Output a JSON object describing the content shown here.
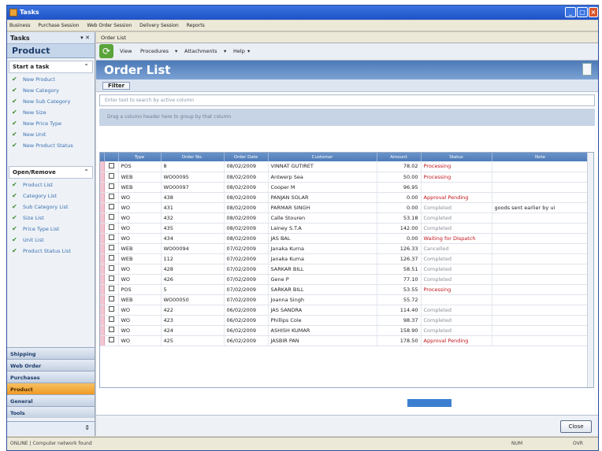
{
  "window": {
    "title": "Tasks"
  },
  "menu": [
    "Business",
    "Purchase Session",
    "Web Order Session",
    "Delivery Session",
    "Reports"
  ],
  "tasks_pane": {
    "header": "Tasks",
    "section_title": "Product",
    "group1": {
      "title": "Start a task",
      "items": [
        "New Product",
        "New Category",
        "New Sub Category",
        "New Size",
        "New Price Type",
        "New Unit",
        "New Product Status"
      ]
    },
    "group2": {
      "title": "Open/Remove",
      "items": [
        "Product List",
        "Category List",
        "Sub Category List",
        "Size List",
        "Price Type List",
        "Unit List",
        "Product Status List"
      ]
    },
    "nav": [
      "Shipping",
      "Web Order",
      "Purchases",
      "Product",
      "General",
      "Tools"
    ]
  },
  "doc_tab": "Order List",
  "toolbar": {
    "view": "View",
    "procedures": "Procedures",
    "attachments": "Attachments",
    "help": "Help"
  },
  "page_title": "Order List",
  "filter_label": "Filter",
  "search_placeholder": "Enter text to search by active column",
  "group_hint": "Drag a column header here to group by that column",
  "table": {
    "columns": [
      "",
      "Type",
      "Order No.",
      "Order Date",
      "Customer",
      "Amount",
      "Status",
      "Note"
    ],
    "rows": [
      {
        "type": "POS",
        "no": "8",
        "date": "08/02/2009",
        "cust": "VINNAT GUTIRET",
        "amt": "78.02",
        "status": "Processing",
        "sc": "red",
        "note": ""
      },
      {
        "type": "WEB",
        "no": "WO00095",
        "date": "08/02/2009",
        "cust": "Antwerp Sea",
        "amt": "50.00",
        "status": "Processing",
        "sc": "red",
        "note": ""
      },
      {
        "type": "WEB",
        "no": "WO00097",
        "date": "08/02/2009",
        "cust": "Cooper M",
        "amt": "96.95",
        "status": "",
        "sc": "gray",
        "note": ""
      },
      {
        "type": "WO",
        "no": "438",
        "date": "08/02/2009",
        "cust": "PANJAN SOLAR",
        "amt": "0.00",
        "status": "Approval Pending",
        "sc": "red",
        "note": ""
      },
      {
        "type": "WO",
        "no": "431",
        "date": "08/02/2009",
        "cust": "PARMAR SINGH",
        "amt": "0.00",
        "status": "Completed",
        "sc": "gray",
        "note": "goods sent earlier by ui"
      },
      {
        "type": "WO",
        "no": "432",
        "date": "08/02/2009",
        "cust": "Calle Stouren",
        "amt": "53.18",
        "status": "Completed",
        "sc": "gray",
        "note": ""
      },
      {
        "type": "WO",
        "no": "435",
        "date": "08/02/2009",
        "cust": "Lainey S.T.A",
        "amt": "142.00",
        "status": "Completed",
        "sc": "gray",
        "note": ""
      },
      {
        "type": "WO",
        "no": "434",
        "date": "08/02/2009",
        "cust": "JAS BAL",
        "amt": "0.00",
        "status": "Waiting for Dispatch",
        "sc": "red",
        "note": ""
      },
      {
        "type": "WEB",
        "no": "WO00094",
        "date": "07/02/2009",
        "cust": "Janaka Kurna",
        "amt": "126.33",
        "status": "Cancelled",
        "sc": "gray",
        "note": ""
      },
      {
        "type": "WEB",
        "no": "112",
        "date": "07/02/2009",
        "cust": "Janaka Kurna",
        "amt": "126.37",
        "status": "Completed",
        "sc": "gray",
        "note": ""
      },
      {
        "type": "WO",
        "no": "428",
        "date": "07/02/2009",
        "cust": "SARKAR BILL",
        "amt": "58.51",
        "status": "Completed",
        "sc": "gray",
        "note": ""
      },
      {
        "type": "WO",
        "no": "426",
        "date": "07/02/2009",
        "cust": "Gene P",
        "amt": "77.10",
        "status": "Completed",
        "sc": "gray",
        "note": ""
      },
      {
        "type": "POS",
        "no": "5",
        "date": "07/02/2009",
        "cust": "SARKAR BILL",
        "amt": "53.55",
        "status": "Processing",
        "sc": "red",
        "note": ""
      },
      {
        "type": "WEB",
        "no": "WO00050",
        "date": "07/02/2009",
        "cust": "Joanna Singh",
        "amt": "55.72",
        "status": "",
        "sc": "gray",
        "note": ""
      },
      {
        "type": "WO",
        "no": "422",
        "date": "06/02/2009",
        "cust": "JAS SANDRA",
        "amt": "114.40",
        "status": "Completed",
        "sc": "gray",
        "note": ""
      },
      {
        "type": "WO",
        "no": "423",
        "date": "06/02/2009",
        "cust": "Phillips Cole",
        "amt": "98.37",
        "status": "Completed",
        "sc": "gray",
        "note": ""
      },
      {
        "type": "WO",
        "no": "424",
        "date": "06/02/2009",
        "cust": "ASHISH KUMAR",
        "amt": "158.90",
        "status": "Completed",
        "sc": "gray",
        "note": ""
      },
      {
        "type": "WO",
        "no": "425",
        "date": "06/02/2009",
        "cust": "JASBIR PAN",
        "amt": "178.50",
        "status": "Approval Pending",
        "sc": "red",
        "note": ""
      }
    ]
  },
  "close_button": "Close",
  "status": {
    "left": "ONLINE | Computer network found",
    "r1": "NUM",
    "r2": "OVR"
  }
}
